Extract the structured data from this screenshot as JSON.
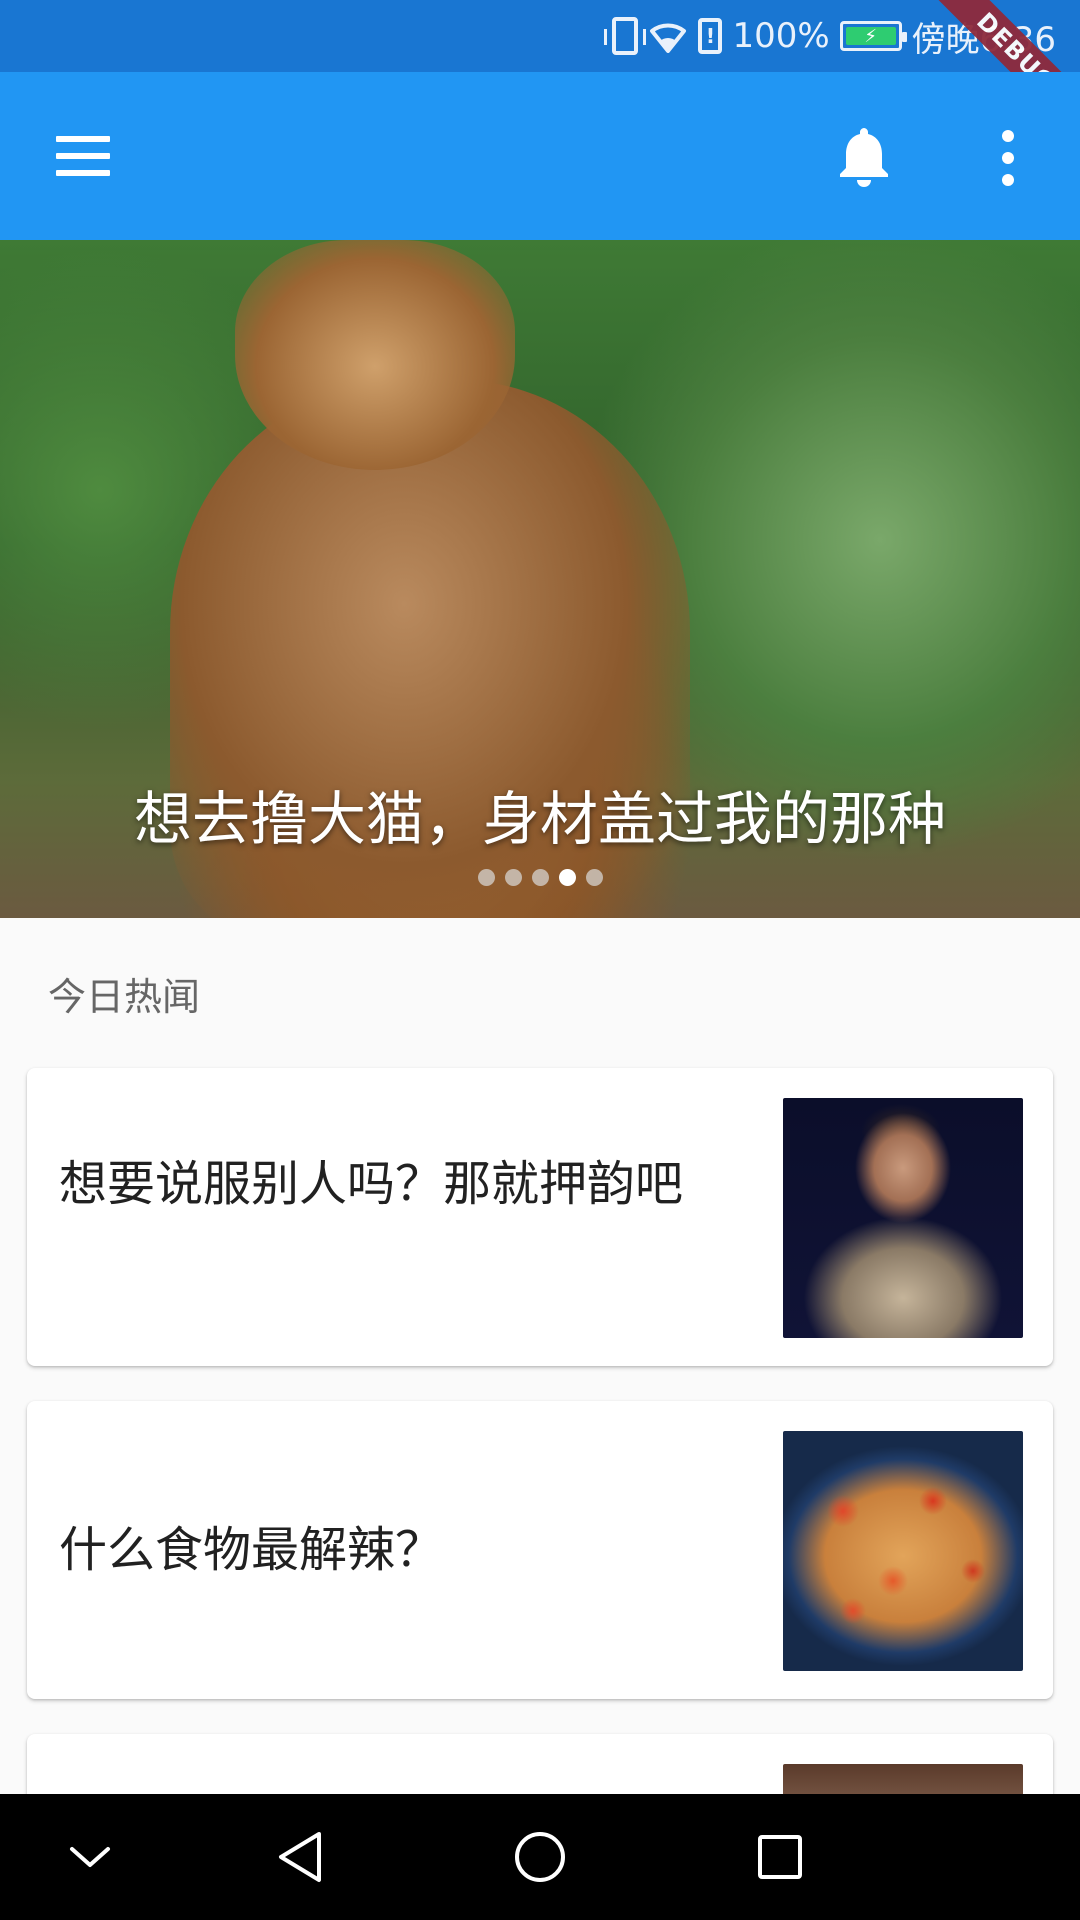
{
  "status_bar": {
    "battery_percent": "100%",
    "time": "傍晚6:36",
    "debug_label": "DEBUG",
    "icons": [
      "vibrate-icon",
      "wifi-icon",
      "alert-icon",
      "battery-charging-icon"
    ],
    "battery_color": "#2ecc71"
  },
  "app_bar": {
    "color": "#2196F3",
    "icons": [
      "menu-icon",
      "notifications-icon",
      "more-vert-icon"
    ]
  },
  "banner": {
    "caption": "想去撸大猫，身材盖过我的那种",
    "page_count": 5,
    "active_index": 3
  },
  "section": {
    "title": "今日热闻"
  },
  "cards": [
    {
      "title": "想要说服别人吗？那就押韵吧"
    },
    {
      "title": "什么食物最解辣？"
    },
    {
      "title": ""
    }
  ],
  "nav": {
    "icons": [
      "chevron-down-icon",
      "back-icon",
      "home-icon",
      "recents-icon"
    ]
  }
}
